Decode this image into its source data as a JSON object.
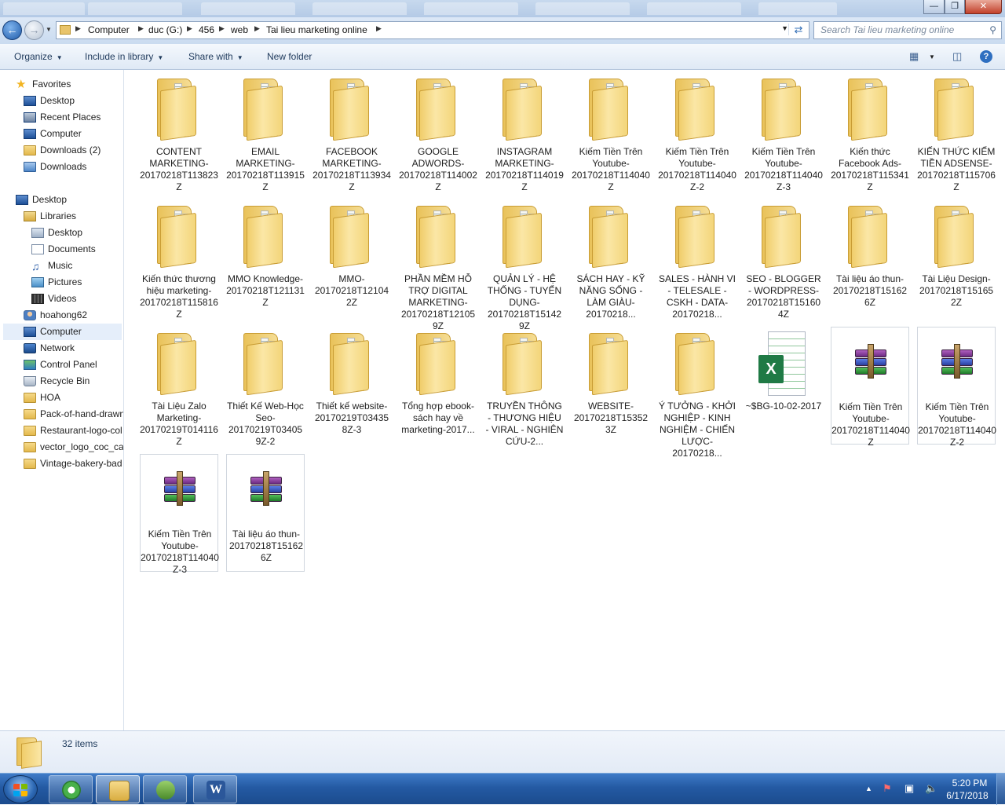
{
  "window": {
    "background_tabs": [
      "",
      "",
      "",
      "",
      "",
      "",
      "",
      ""
    ]
  },
  "address": {
    "crumbs": [
      "Computer",
      "duc (G:)",
      "456",
      "web",
      "Tai lieu marketing online"
    ]
  },
  "search": {
    "placeholder": "Search Tai lieu marketing online"
  },
  "toolbar": {
    "organize": "Organize",
    "include_in_library": "Include in library",
    "share_with": "Share with",
    "new_folder": "New folder"
  },
  "nav": {
    "favorites": "Favorites",
    "fav_items": [
      "Desktop",
      "Recent Places",
      "Computer",
      "Downloads (2)",
      "Downloads"
    ],
    "desktop": "Desktop",
    "libraries": "Libraries",
    "lib_items": [
      "Desktop",
      "Documents",
      "Music",
      "Pictures",
      "Videos"
    ],
    "user": "hoahong62",
    "computer": "Computer",
    "network": "Network",
    "control_panel": "Control Panel",
    "recycle_bin": "Recycle Bin",
    "folders": [
      "HOA",
      "Pack-of-hand-drawn",
      "Restaurant-logo-col",
      "vector_logo_coc_caf",
      "Vintage-bakery-bad"
    ]
  },
  "items": [
    {
      "type": "folder",
      "label": "CONTENT MARKETING-20170218T113823Z"
    },
    {
      "type": "folder",
      "label": "EMAIL MARKETING-20170218T113915Z"
    },
    {
      "type": "folder",
      "label": "FACEBOOK MARKETING-20170218T113934Z"
    },
    {
      "type": "folder",
      "label": "GOOGLE ADWORDS-20170218T114002Z"
    },
    {
      "type": "folder",
      "label": "INSTAGRAM MARKETING-20170218T114019Z"
    },
    {
      "type": "folder",
      "label": "Kiếm Tiền Trên Youtube-20170218T114040Z"
    },
    {
      "type": "folder",
      "label": "Kiếm Tiền Trên Youtube-20170218T114040Z-2"
    },
    {
      "type": "folder",
      "label": "Kiếm Tiền Trên Youtube-20170218T114040Z-3"
    },
    {
      "type": "folder",
      "label": "Kiến thức Facebook Ads-20170218T115341Z"
    },
    {
      "type": "folder",
      "label": "KIẾN THỨC KIẾM TIỀN ADSENSE-20170218T115706Z"
    },
    {
      "type": "folder",
      "label": "Kiến thức thương hiệu marketing-20170218T115816Z"
    },
    {
      "type": "folder",
      "label": "MMO Knowledge-20170218T121131Z"
    },
    {
      "type": "folder",
      "label": "MMO-20170218T121042Z"
    },
    {
      "type": "folder",
      "label": "PHẦN MỀM HỖ TRỢ DIGITAL MARKETING-20170218T121059Z"
    },
    {
      "type": "folder",
      "label": "QUẢN LÝ - HỆ THỐNG - TUYỂN DỤNG-20170218T151429Z"
    },
    {
      "type": "folder",
      "label": "SÁCH HAY - KỸ NĂNG SỐNG - LÀM GIÀU-20170218..."
    },
    {
      "type": "folder",
      "label": "SALES - HÀNH VI - TELESALE - CSKH - DATA-20170218..."
    },
    {
      "type": "folder",
      "label": "SEO - BLOGGER - WORDPRESS-20170218T151604Z"
    },
    {
      "type": "folder",
      "label": "Tài liệu áo thun-20170218T151626Z"
    },
    {
      "type": "folder",
      "label": "Tài Liệu Design-20170218T151652Z"
    },
    {
      "type": "folder",
      "label": "Tài Liệu Zalo Marketing-20170219T014116Z"
    },
    {
      "type": "folder",
      "label": "Thiết Kế Web-Học Seo-20170219T034059Z-2"
    },
    {
      "type": "folder",
      "label": "Thiết kế website-20170219T034358Z-3"
    },
    {
      "type": "folder",
      "label": "Tổng hợp ebook-sách hay về marketing-2017..."
    },
    {
      "type": "folder",
      "label": "TRUYỀN THÔNG - THƯƠNG HIỆU - VIRAL - NGHIÊN CỨU-2..."
    },
    {
      "type": "folder",
      "label": "WEBSITE-20170218T153523Z"
    },
    {
      "type": "folder",
      "label": "Ý TƯỞNG - KHỞI NGHIỆP - KINH NGHIỆM - CHIẾN LƯỢC-20170218..."
    },
    {
      "type": "excel",
      "label": "~$BG-10-02-2017"
    },
    {
      "type": "rar",
      "label": "Kiếm Tiền Trên Youtube-20170218T114040Z"
    },
    {
      "type": "rar",
      "label": "Kiếm Tiền Trên Youtube-20170218T114040Z-2"
    },
    {
      "type": "rar",
      "label": "Kiếm Tiền Trên Youtube-20170218T114040Z-3"
    },
    {
      "type": "rar",
      "label": "Tài liệu áo thun-20170218T151626Z"
    }
  ],
  "status": {
    "item_count": "32 items"
  },
  "taskbar": {
    "time": "5:20 PM",
    "date": "6/17/2018"
  }
}
